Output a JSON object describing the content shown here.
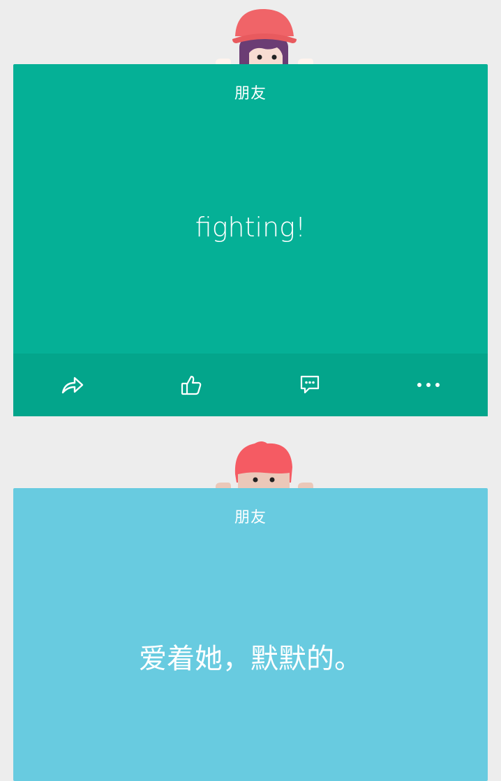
{
  "posts": [
    {
      "category": "朋友",
      "message": "fighting!",
      "card_color": "#05b096",
      "avatar": "girl-with-pink-hat-icon",
      "actions": [
        {
          "name": "share",
          "icon": "share-icon"
        },
        {
          "name": "like",
          "icon": "thumbs-up-icon"
        },
        {
          "name": "comment",
          "icon": "comment-icon"
        },
        {
          "name": "more",
          "icon": "more-icon"
        }
      ]
    },
    {
      "category": "朋友",
      "message": "爱着她，默默的。",
      "card_color": "#68cbe0",
      "avatar": "boy-with-red-hair-icon"
    }
  ]
}
